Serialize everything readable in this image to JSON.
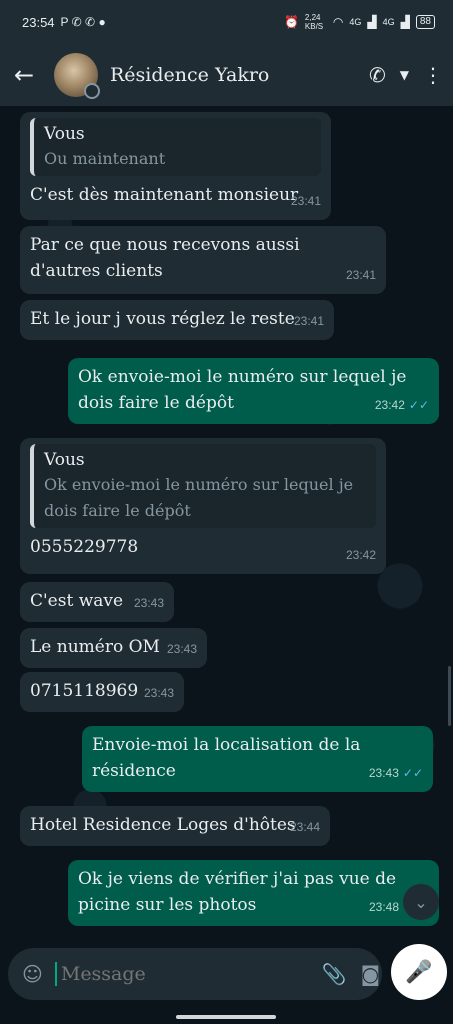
{
  "statusbar": {
    "time": "23:54",
    "left_icons": "P ✆ ✆ ●",
    "speed": "2,24 KB/S",
    "net1": "4G",
    "net2": "4G",
    "battery": "88"
  },
  "header": {
    "back_icon": "arrow-left-icon",
    "contact_name": "Résidence Yakro",
    "call_icon": "phone-icon",
    "dropdown_icon": "chevron-down-icon",
    "menu_icon": "more-vertical-icon"
  },
  "messages": [
    {
      "dir": "in",
      "quote_author": "Vous",
      "quote_text": "Ou maintenant",
      "text": "C'est dès maintenant monsieur",
      "time": "23:41"
    },
    {
      "dir": "in",
      "text": "Par ce que nous recevons aussi d'autres clients",
      "time": "23:41"
    },
    {
      "dir": "in",
      "text": "Et le jour j vous réglez le reste",
      "time": "23:41"
    },
    {
      "dir": "out",
      "text": "Ok envoie-moi le numéro sur lequel je dois faire le dépôt",
      "time": "23:42"
    },
    {
      "dir": "in",
      "quote_author": "Vous",
      "quote_text": "Ok envoie-moi le numéro sur lequel je dois faire le dépôt",
      "text": "0555229778",
      "time": "23:42"
    },
    {
      "dir": "in",
      "text": "C'est wave",
      "time": "23:43"
    },
    {
      "dir": "in",
      "text": "Le numéro OM",
      "time": "23:43"
    },
    {
      "dir": "in",
      "text": "0715118969",
      "time": "23:43"
    },
    {
      "dir": "out",
      "text": "Envoie-moi la localisation de la résidence",
      "time": "23:43"
    },
    {
      "dir": "in",
      "text": "Hotel Residence Loges d'hôtes",
      "time": "23:44"
    },
    {
      "dir": "out",
      "text": "Ok je viens de vérifier j'ai pas vue de picine sur les photos",
      "time": "23:48"
    }
  ],
  "composer": {
    "placeholder": "Message",
    "emoji_icon": "sticker-icon",
    "attach_icon": "paperclip-icon",
    "camera_icon": "camera-icon",
    "mic_icon": "mic-icon"
  },
  "colors": {
    "background": "#0b141a",
    "incoming_bubble": "#202c33",
    "outgoing_bubble": "#005c4b",
    "read_ticks": "#53bdeb"
  }
}
